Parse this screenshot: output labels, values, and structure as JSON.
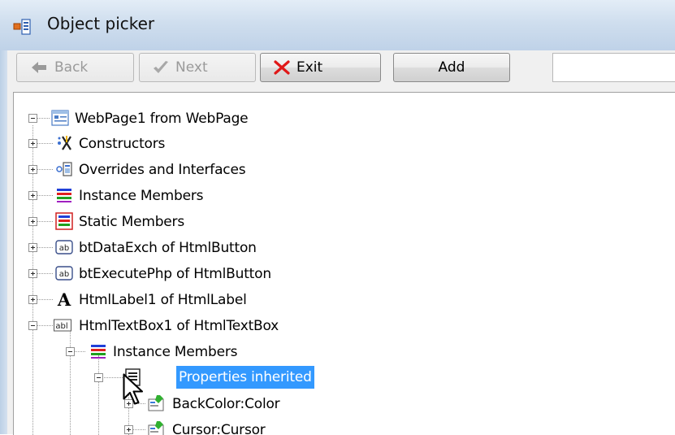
{
  "window": {
    "title": "Object picker",
    "icon": "object-picker-icon"
  },
  "toolbar": {
    "back_label": "Back",
    "next_label": "Next",
    "exit_label": "Exit",
    "add_label": "Add",
    "search_value": ""
  },
  "tree": {
    "root": {
      "label": "WebPage1 from WebPage",
      "icon": "webpage-icon"
    },
    "items": [
      {
        "label": "Constructors",
        "icon": "constructors-icon"
      },
      {
        "label": "Overrides and Interfaces",
        "icon": "overrides-icon"
      },
      {
        "label": "Instance Members",
        "icon": "instance-members-icon"
      },
      {
        "label": "Static Members",
        "icon": "static-members-icon"
      },
      {
        "label": "btDataExch of HtmlButton",
        "icon": "button-ab-icon"
      },
      {
        "label": "btExecutePhp of HtmlButton",
        "icon": "button-ab-icon"
      },
      {
        "label": "HtmlLabel1 of HtmlLabel",
        "icon": "label-a-icon"
      },
      {
        "label": "HtmlTextBox1 of HtmlTextBox",
        "icon": "textbox-abl-icon"
      }
    ],
    "textbox_children": [
      {
        "label": "Instance Members",
        "icon": "instance-members-icon"
      }
    ],
    "instance_children": [
      {
        "label": "Properties inherited",
        "icon": "properties-icon",
        "selected": true
      }
    ],
    "property_children": [
      {
        "label": "BackColor:Color",
        "icon": "property-icon"
      },
      {
        "label": "Cursor:Cursor",
        "icon": "property-icon"
      }
    ]
  },
  "colors": {
    "selection": "#3399ff",
    "titlebar": "#cfdeee"
  }
}
